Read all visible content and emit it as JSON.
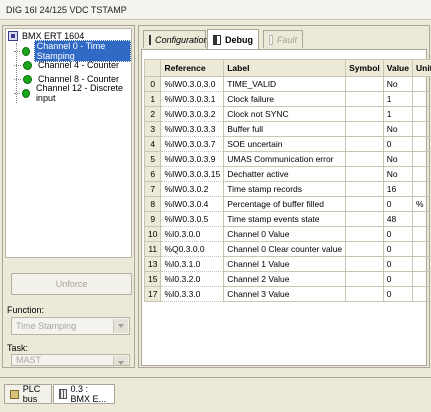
{
  "window": {
    "title": "DIG 16I 24/125 VDC TSTAMP"
  },
  "tree": {
    "root": "BMX ERT 1604",
    "items": [
      {
        "label": "Channel 0 - Time Stamping",
        "selected": true
      },
      {
        "label": "Channel 4 - Counter",
        "selected": false
      },
      {
        "label": "Channel 8 - Counter",
        "selected": false
      },
      {
        "label": "Channel 12 - Discrete input",
        "selected": false
      }
    ]
  },
  "left": {
    "unforce_label": "Unforce",
    "function_label": "Function:",
    "function_value": "Time Stamping",
    "task_label": "Task:",
    "task_value": "MAST"
  },
  "tabs": [
    {
      "label": "Configuration"
    },
    {
      "label": "Debug"
    },
    {
      "label": "Fault"
    }
  ],
  "table": {
    "headers": [
      "",
      "Reference",
      "Label",
      "Symbol",
      "Value",
      "Unit"
    ],
    "rows": [
      [
        "0",
        "%IW0.3.0.3.0",
        "TIME_VALID",
        "",
        "No",
        ""
      ],
      [
        "1",
        "%IW0.3.0.3.1",
        "Clock failure",
        "",
        "1",
        ""
      ],
      [
        "2",
        "%IW0.3.0.3.2",
        "Clock not SYNC",
        "",
        "1",
        ""
      ],
      [
        "3",
        "%IW0.3.0.3.3",
        "Buffer full",
        "",
        "No",
        ""
      ],
      [
        "4",
        "%IW0.3.0.3.7",
        "SOE uncertain",
        "",
        "0",
        ""
      ],
      [
        "5",
        "%IW0.3.0.3.9",
        "UMAS Communication error",
        "",
        "No",
        ""
      ],
      [
        "6",
        "%IW0.3.0.3.15",
        "Dechatter active",
        "",
        "No",
        ""
      ],
      [
        "7",
        "%IW0.3.0.2",
        "Time stamp records",
        "",
        "16",
        ""
      ],
      [
        "8",
        "%IW0.3.0.4",
        "Percentage of buffer filled",
        "",
        "0",
        "%"
      ],
      [
        "9",
        "%IW0.3.0.5",
        "Time stamp events state",
        "",
        "48",
        ""
      ],
      [
        "10",
        "%I0.3.0.0",
        "Channel 0 Value",
        "",
        "0",
        ""
      ],
      [
        "11",
        "%Q0.3.0.0",
        "Channel 0 Clear counter value",
        "",
        "0",
        ""
      ],
      [
        "13",
        "%I0.3.1.0",
        "Channel 1 Value",
        "",
        "0",
        ""
      ],
      [
        "15",
        "%I0.3.2.0",
        "Channel 2 Value",
        "",
        "0",
        ""
      ],
      [
        "17",
        "%I0.3.3.0",
        "Channel 3 Value",
        "",
        "0",
        ""
      ]
    ]
  },
  "bottom_tabs": [
    {
      "label": "PLC bus"
    },
    {
      "label": "0.3 : BMX E..."
    }
  ],
  "colors": {
    "selection": "#316ac5",
    "status_ok": "#1aa81a",
    "chrome": "#ece9d8"
  }
}
